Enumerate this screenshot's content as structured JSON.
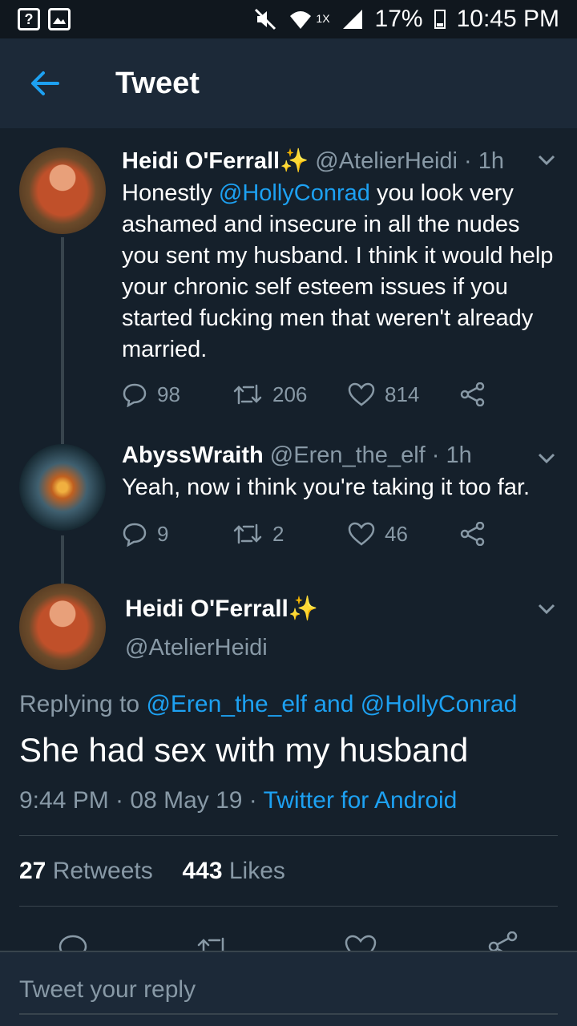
{
  "status_bar": {
    "battery": "17%",
    "time": "10:45 PM",
    "net_label": "1X",
    "left_icons": [
      "help-box-icon",
      "image-icon"
    ],
    "right_icons": [
      "mute-icon",
      "wifi-icon",
      "signal-icon",
      "battery-icon"
    ]
  },
  "header": {
    "title": "Tweet",
    "back_icon": "back-arrow-icon"
  },
  "colors": {
    "background": "#15202b",
    "header": "#1c2938",
    "link": "#1da1f2",
    "muted": "#8899a6"
  },
  "thread": [
    {
      "name": "Heidi O'Ferrall",
      "badge": "✨",
      "handle": "@AtelierHeidi",
      "sep": "·",
      "time": "1h",
      "text_before": "Honestly ",
      "mention": "@HollyConrad",
      "text_after": " you look very ashamed and insecure in all the nudes you sent my husband. I think it would help your chronic self esteem issues if you started fucking men that weren't already married.",
      "replies": "98",
      "retweets": "206",
      "likes": "814"
    },
    {
      "name": "AbyssWraith",
      "badge": "",
      "handle": "@Eren_the_elf",
      "sep": "·",
      "time": "1h",
      "text_before": "Yeah, now i think you're taking it too far.",
      "mention": "",
      "text_after": "",
      "replies": "9",
      "retweets": "2",
      "likes": "46"
    }
  ],
  "main_tweet": {
    "name": "Heidi O'Ferrall",
    "badge": "✨",
    "handle": "@AtelierHeidi",
    "replying_prefix": "Replying to ",
    "reply_mention_1": "@Eren_the_elf",
    "reply_and": " and ",
    "reply_mention_2": "@HollyConrad",
    "text": "She had sex with my husband",
    "date": "9:44 PM · 08 May 19 · ",
    "source": "Twitter for Android",
    "retweets_count": "27",
    "retweets_label": " Retweets",
    "likes_count": "443",
    "likes_label": " Likes"
  },
  "reply_bar": {
    "placeholder": "Tweet your reply"
  }
}
